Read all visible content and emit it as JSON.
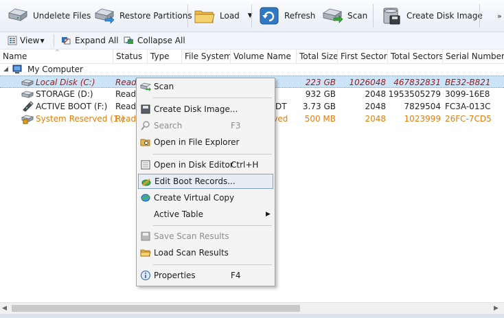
{
  "toolbar": {
    "undelete_label": "Undelete Files",
    "restore_label": "Restore Partitions",
    "load_label": "Load",
    "refresh_label": "Refresh",
    "scan_label": "Scan",
    "create_image_label": "Create Disk Image",
    "more_label": "»"
  },
  "toolbar2": {
    "view_label": "View",
    "expand_label": "Expand All",
    "collapse_label": "Collapse All"
  },
  "columns": [
    "Name",
    "Status",
    "Type",
    "File System",
    "Volume Name",
    "Total Size",
    "First Sector",
    "Total Sectors",
    "Serial Number"
  ],
  "tree": {
    "root_label": "My Computer",
    "rows": [
      {
        "name": "Local Disk (C:)",
        "status": "Ready",
        "size": "223 GB",
        "first": "1026048",
        "total": "467832831",
        "serial": "BE32-B821"
      },
      {
        "name": "STORAGE (D:)",
        "status": "Ready",
        "size": "932 GB",
        "first": "2048",
        "total": "1953505279",
        "serial": "3099-16E8"
      },
      {
        "name": "ACTIVE BOOT (F:)",
        "status": "Ready",
        "volfrag": "DT",
        "size": "3.73 GB",
        "first": "2048",
        "total": "7829504",
        "serial": "FC3A-013C"
      },
      {
        "name": "System Reserved (1:)",
        "status": "Ready",
        "volfrag": "erved",
        "size": "500 MB",
        "first": "2048",
        "total": "1023999",
        "serial": "26FC-7CD5"
      }
    ]
  },
  "menu": {
    "scan": "Scan",
    "create_image": "Create Disk Image...",
    "search": "Search",
    "search_sc": "F3",
    "open_explorer": "Open in File Explorer",
    "open_editor": "Open in Disk Editor",
    "open_editor_sc": "Ctrl+H",
    "edit_boot": "Edit Boot Records...",
    "virtual_copy": "Create Virtual Copy",
    "active_table": "Active Table",
    "save_scan": "Save Scan Results",
    "load_scan": "Load Scan Results",
    "properties": "Properties",
    "properties_sc": "F4"
  }
}
